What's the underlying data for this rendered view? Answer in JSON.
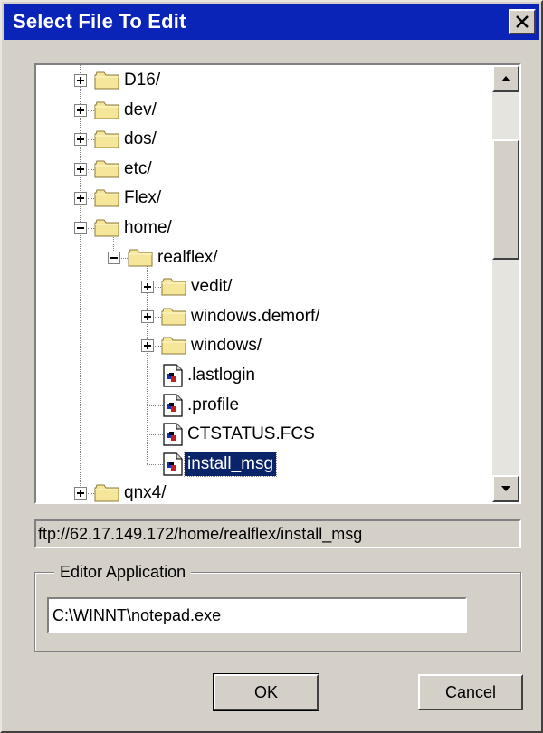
{
  "window": {
    "title": "Select File To Edit"
  },
  "tree": {
    "items": [
      {
        "label": "D16/",
        "type": "folder",
        "level": 0,
        "expander": "plus"
      },
      {
        "label": "dev/",
        "type": "folder",
        "level": 0,
        "expander": "plus"
      },
      {
        "label": "dos/",
        "type": "folder",
        "level": 0,
        "expander": "plus"
      },
      {
        "label": "etc/",
        "type": "folder",
        "level": 0,
        "expander": "plus"
      },
      {
        "label": "Flex/",
        "type": "folder",
        "level": 0,
        "expander": "plus"
      },
      {
        "label": "home/",
        "type": "folder",
        "level": 0,
        "expander": "minus"
      },
      {
        "label": "realflex/",
        "type": "folder",
        "level": 1,
        "expander": "minus"
      },
      {
        "label": "vedit/",
        "type": "folder",
        "level": 2,
        "expander": "plus"
      },
      {
        "label": "windows.demorf/",
        "type": "folder",
        "level": 2,
        "expander": "plus"
      },
      {
        "label": "windows/",
        "type": "folder",
        "level": 2,
        "expander": "plus"
      },
      {
        "label": ".lastlogin",
        "type": "file",
        "level": 2,
        "expander": "none"
      },
      {
        "label": ".profile",
        "type": "file",
        "level": 2,
        "expander": "none"
      },
      {
        "label": "CTSTATUS.FCS",
        "type": "file",
        "level": 2,
        "expander": "none"
      },
      {
        "label": "install_msg",
        "type": "file",
        "level": 2,
        "expander": "none",
        "selected": true
      },
      {
        "label": "qnx4/",
        "type": "folder",
        "level": 0,
        "expander": "plus"
      }
    ]
  },
  "path": {
    "value": "ftp://62.17.149.172/home/realflex/install_msg"
  },
  "editor": {
    "legend": "Editor Application",
    "value": "C:\\WINNT\\notepad.exe"
  },
  "buttons": {
    "ok": "OK",
    "cancel": "Cancel"
  },
  "colors": {
    "titlebar": "#0a24b8",
    "selection": "#0a246a",
    "face": "#d4d0c8",
    "folder": "#f6e69a"
  }
}
